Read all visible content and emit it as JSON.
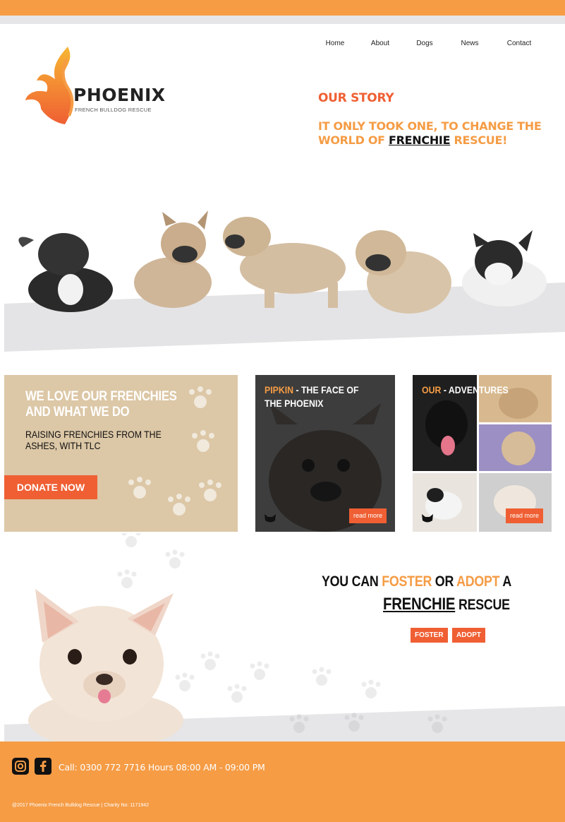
{
  "nav": {
    "items": [
      "Home",
      "About",
      "Dogs",
      "News",
      "Contact"
    ]
  },
  "logo": {
    "word": "PHOENIX",
    "subtitle": "FRENCH BULLDOG RESCUE"
  },
  "story": {
    "title": "OUR STORY",
    "subtitle_part1": "IT ONLY TOOK ONE, TO CHANGE THE WORLD OF ",
    "subtitle_emph": "FRENCHIE",
    "subtitle_part2": " RESCUE!"
  },
  "card_love": {
    "title": "WE LOVE OUR FRENCHIES AND WHAT WE DO",
    "subtitle": "RAISING FRENCHIES FROM THE ASHES, WITH TLC",
    "button": "DONATE NOW"
  },
  "card_pipkin": {
    "title_highlight": "PIPKIN",
    "title_rest": " - THE FACE OF THE PHOENIX",
    "button": "read more"
  },
  "card_adventures": {
    "title_highlight": "OUR",
    "title_rest": " - ADVENTURES",
    "button": "read more"
  },
  "foster": {
    "line1_a": "YOU CAN ",
    "line1_b": "FOSTER",
    "line1_c": " OR ",
    "line1_d": "ADOPT",
    "line1_e": " A",
    "line2_a": "FRENCHIE",
    "line2_b": " RESCUE",
    "foster_button": "FOSTER",
    "adopt_button": "ADOPT"
  },
  "footer": {
    "call": "Call: 0300 772 7716 Hours 08:00 AM - 09:00 PM",
    "copyright": "@2017 Phoenix French Bulldog Rescue | Charity No: 1171942",
    "social_icons": [
      "instagram-icon",
      "facebook-icon"
    ]
  },
  "colors": {
    "brand_orange": "#f59c45",
    "accent_red": "#ef5f33",
    "card_tan": "#dcc7a6"
  }
}
